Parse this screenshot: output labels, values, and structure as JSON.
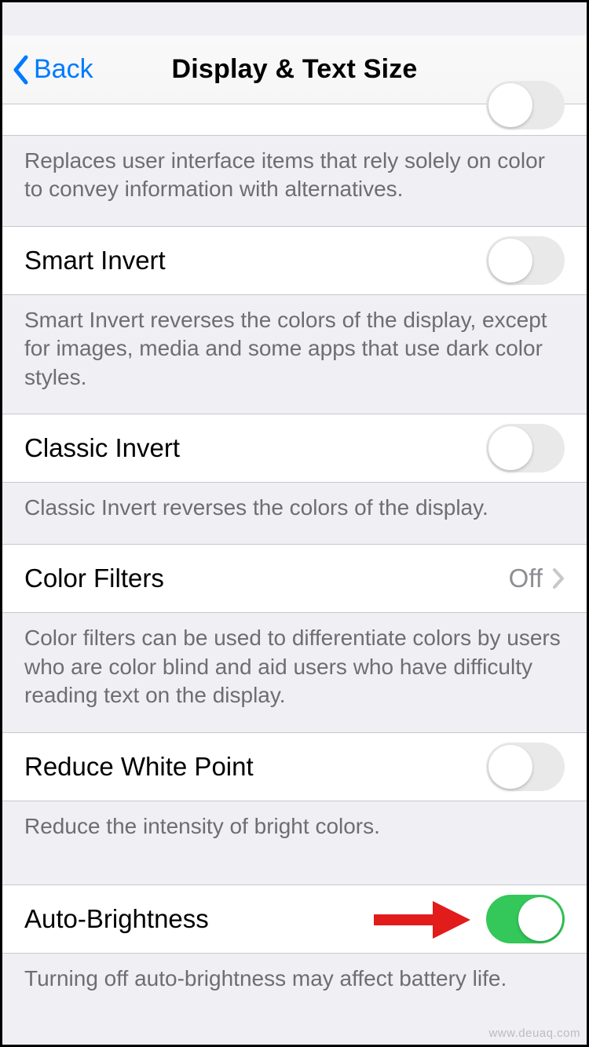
{
  "nav": {
    "back_label": "Back",
    "title": "Display & Text Size"
  },
  "sections": {
    "differentiate": {
      "footer": "Replaces user interface items that rely solely on color to convey information with alternatives."
    },
    "smart_invert": {
      "label": "Smart Invert",
      "on": false,
      "footer": "Smart Invert reverses the colors of the display, except for images, media and some apps that use dark color styles."
    },
    "classic_invert": {
      "label": "Classic Invert",
      "on": false,
      "footer": "Classic Invert reverses the colors of the display."
    },
    "color_filters": {
      "label": "Color Filters",
      "value": "Off",
      "footer": "Color filters can be used to differentiate colors by users who are color blind and aid users who have difficulty reading text on the display."
    },
    "reduce_white_point": {
      "label": "Reduce White Point",
      "on": false,
      "footer": "Reduce the intensity of bright colors."
    },
    "auto_brightness": {
      "label": "Auto-Brightness",
      "on": true,
      "footer": "Turning off auto-brightness may affect battery life."
    }
  },
  "watermark": "www.deuaq.com"
}
